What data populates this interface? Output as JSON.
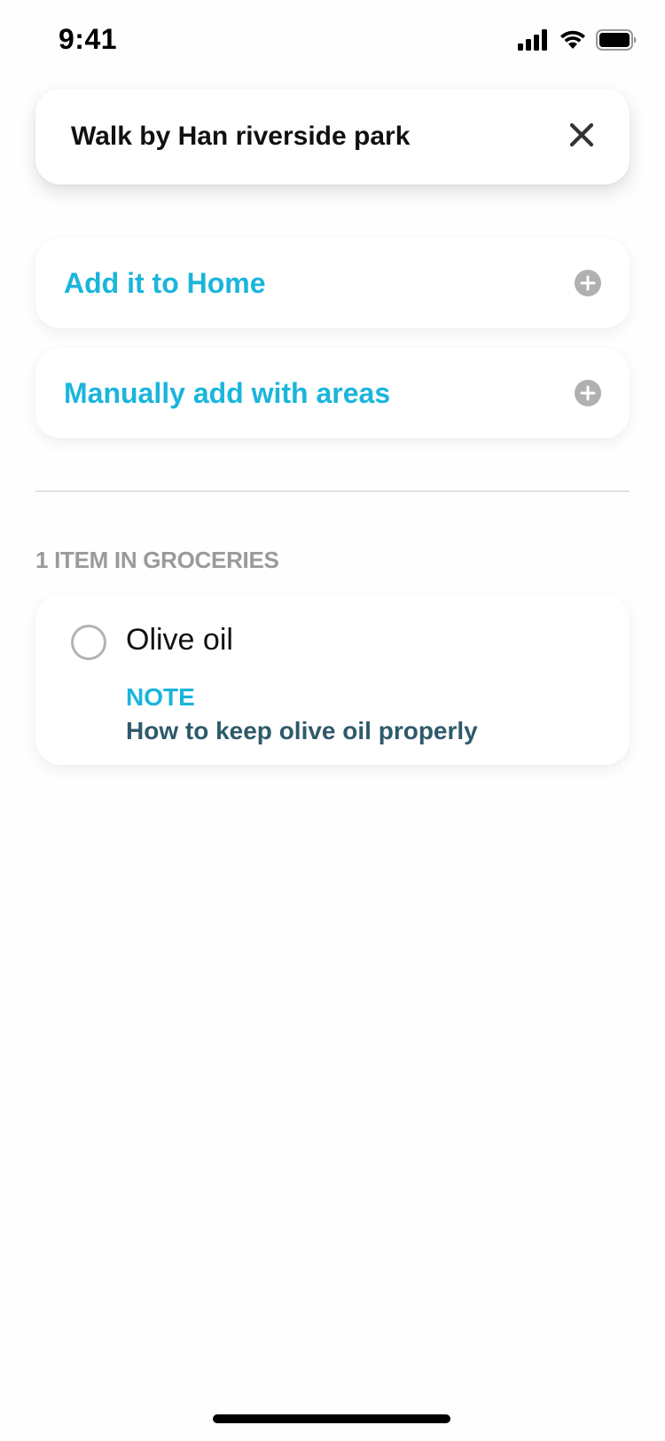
{
  "status_bar": {
    "time": "9:41",
    "icons": [
      "cellular-signal-icon",
      "wifi-icon",
      "battery-icon"
    ]
  },
  "search": {
    "value": "Walk by Han riverside park",
    "clear_icon": "close-icon"
  },
  "actions": [
    {
      "label": "Add it to Home",
      "icon": "plus-circle-icon"
    },
    {
      "label": "Manually add with areas",
      "icon": "plus-circle-icon"
    }
  ],
  "section": {
    "header": "1 ITEM IN GROCERIES"
  },
  "items": [
    {
      "title": "Olive oil",
      "checked": false,
      "note_label": "NOTE",
      "note_text": "How to keep olive oil properly"
    }
  ],
  "colors": {
    "accent": "#1AB5DB",
    "note_text": "#2E5A6B",
    "muted": "#9A9A9A",
    "icon_gray": "#B0B0B0"
  }
}
